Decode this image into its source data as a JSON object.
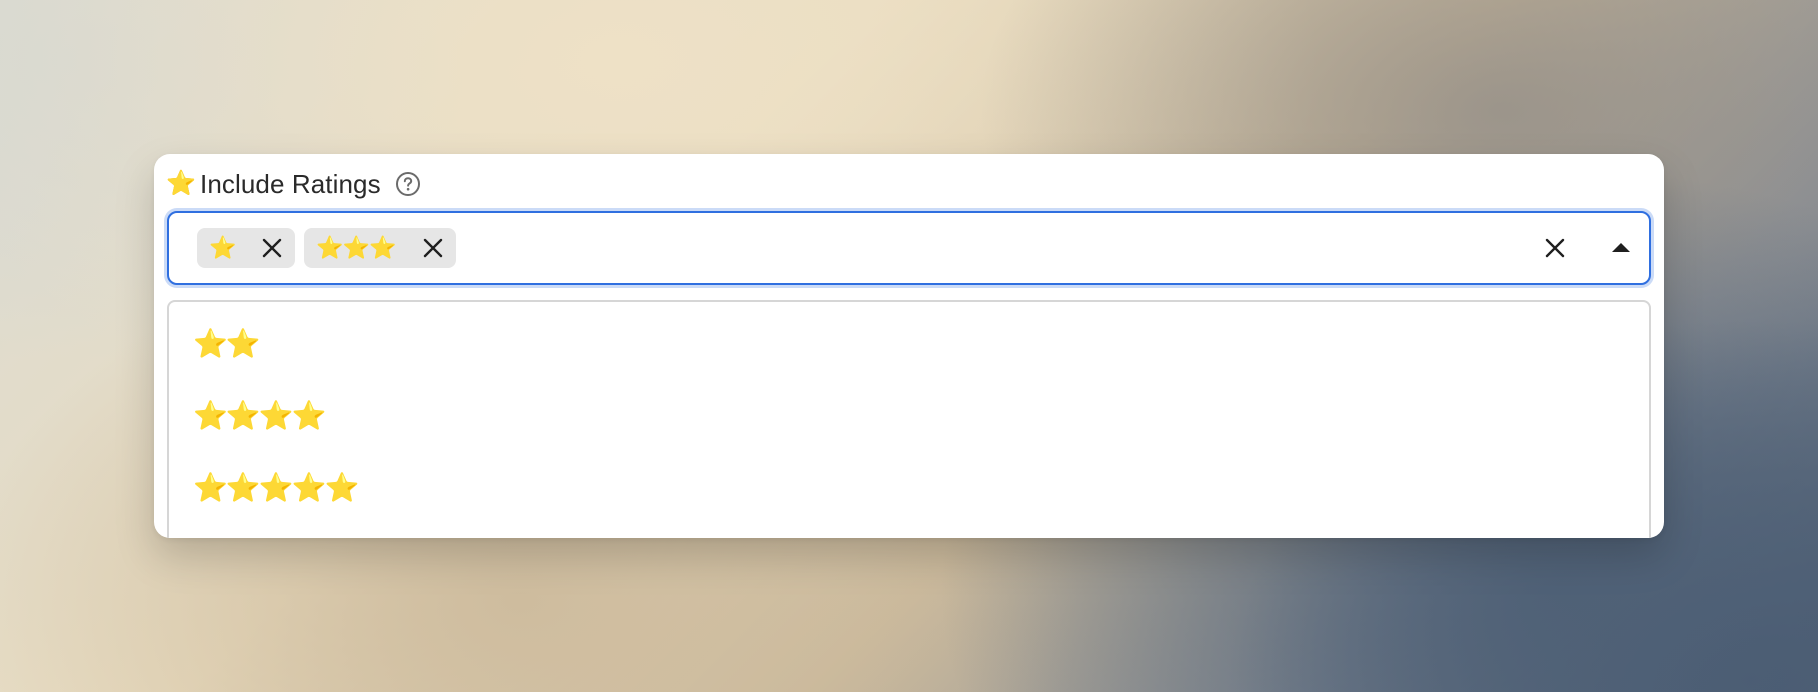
{
  "field": {
    "label_icon": "star-icon",
    "label_icon_glyph": "⭐",
    "label": "Include Ratings",
    "help_icon": "question-circle-icon"
  },
  "selected": [
    {
      "stars": "⭐",
      "rating": 1
    },
    {
      "stars": "⭐⭐⭐",
      "rating": 3
    }
  ],
  "options": [
    {
      "stars": "⭐⭐",
      "rating": 2
    },
    {
      "stars": "⭐⭐⭐⭐",
      "rating": 4
    },
    {
      "stars": "⭐⭐⭐⭐⭐",
      "rating": 5
    }
  ],
  "controls": {
    "clear_icon": "close-icon",
    "toggle_icon": "caret-up-icon"
  },
  "colors": {
    "focus_border": "#2f6fe0",
    "chip_background": "#e6e6e6",
    "star": "#f3b51b"
  }
}
